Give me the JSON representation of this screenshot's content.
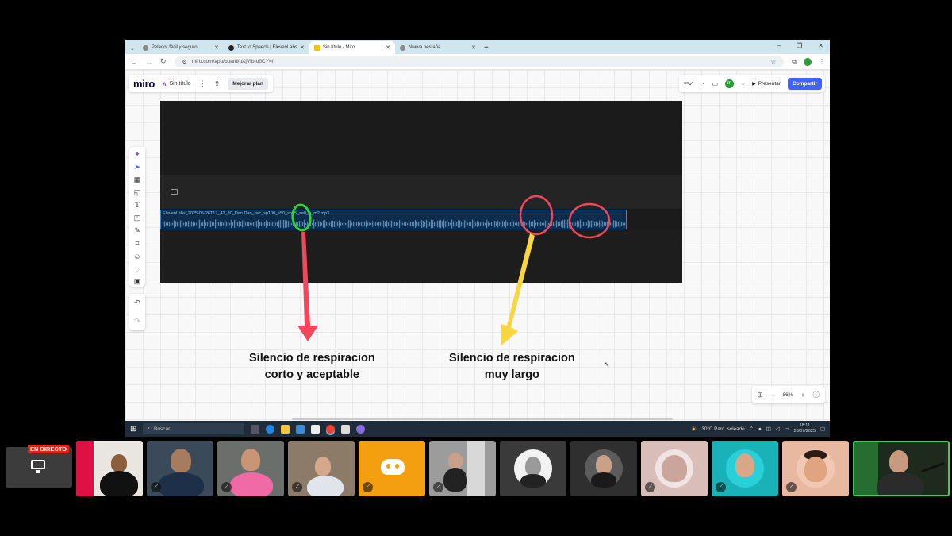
{
  "browser": {
    "tabs": [
      {
        "title": "Pelador fácil y seguro",
        "active": false
      },
      {
        "title": "Text to Speech | ElevenLabs",
        "active": false
      },
      {
        "title": "Sin título - Miro",
        "active": true
      },
      {
        "title": "Nueva pestaña",
        "active": false
      }
    ],
    "url": "miro.com/app/board/uXjVIb-o0CY=/"
  },
  "miro": {
    "logo": "miro",
    "board_name": "Sin título",
    "upgrade_label": "Mejorar plan",
    "avatar_initial": "m",
    "present_label": "Presentar",
    "share_label": "Compartir",
    "zoom": "86%",
    "accent_color": "#4262ff"
  },
  "video": {
    "track_name": "ElevenLabs_2025-05-26T12_42_30_Dan Dan_pvc_sp100_s50_sb75_se0_b_m2.mp3"
  },
  "annotations": {
    "left_caption_line1": "Silencio de respiracion",
    "left_caption_line2": "corto y aceptable",
    "right_caption_line1": "Silencio de respiracion",
    "right_caption_line2": "muy largo",
    "green_color": "#2ed33a",
    "red_color": "#f2475a",
    "yellow_color": "#f7d640"
  },
  "taskbar": {
    "search_placeholder": "Buscar",
    "weather": "30°C  Parc. soleado",
    "time": "18:11",
    "date": "23/07/2025"
  },
  "call": {
    "live_label": "EN DIRECTO"
  }
}
